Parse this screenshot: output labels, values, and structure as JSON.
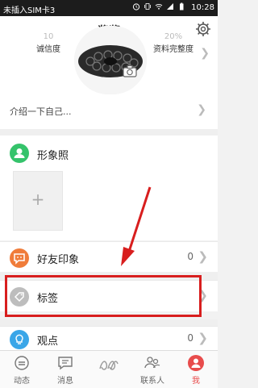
{
  "status_bar": {
    "carrier": "未插入SIM卡3",
    "time": "10:28"
  },
  "profile": {
    "title": "酱酱",
    "stat_left": {
      "value": "10",
      "label": "诚信度"
    },
    "stat_right": {
      "value": "20%",
      "label": "资料完整度"
    },
    "intro_placeholder": "介绍一下自己..."
  },
  "sections": {
    "photo": {
      "label": "形象照"
    },
    "impression": {
      "label": "好友印象",
      "count": "0"
    },
    "tags": {
      "label": "标签"
    },
    "views": {
      "label": "观点",
      "count": "0"
    }
  },
  "tabbar": {
    "items": [
      {
        "label": "动态"
      },
      {
        "label": "消息"
      },
      {
        "label": ""
      },
      {
        "label": "联系人"
      },
      {
        "label": "我"
      }
    ]
  },
  "colors": {
    "accent": "#e84c4c",
    "highlight": "#d81e1e",
    "green": "#35c36b",
    "orange": "#f07c3a",
    "grey": "#bdbdbd",
    "blue": "#3aa6e8"
  }
}
